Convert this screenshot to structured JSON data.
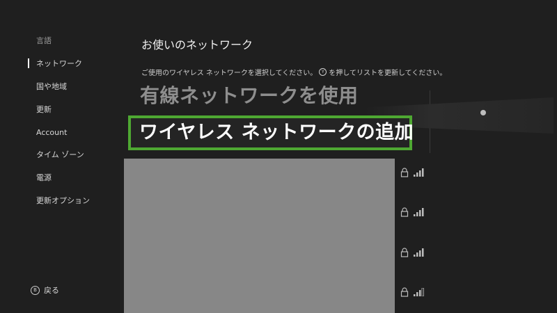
{
  "sidebar": {
    "items": [
      {
        "label": "言語",
        "selected": false
      },
      {
        "label": "ネットワーク",
        "selected": true
      },
      {
        "label": "国や地域",
        "selected": false
      },
      {
        "label": "更新",
        "selected": false
      },
      {
        "label": "Account",
        "selected": false
      },
      {
        "label": "タイム ゾーン",
        "selected": false
      },
      {
        "label": "電源",
        "selected": false
      },
      {
        "label": "更新オプション",
        "selected": false
      }
    ],
    "back": {
      "button_glyph": "B",
      "label": "戻る"
    }
  },
  "main": {
    "title": "お使いのネットワーク",
    "instruction": {
      "before": "ご使用のワイヤレス ネットワークを選択してください。",
      "button_glyph": "Y",
      "after": "を押してリストを更新してください。"
    },
    "wired_option": "有線ネットワークを使用",
    "add_wireless_option": "ワイヤレス ネットワークの追加",
    "networks": [
      {
        "secured": true,
        "signal_bars": 4
      },
      {
        "secured": true,
        "signal_bars": 4
      },
      {
        "secured": true,
        "signal_bars": 4
      },
      {
        "secured": true,
        "signal_bars": 3
      }
    ]
  },
  "colors": {
    "background": "#1f1f1f",
    "focus_border": "#4ea832",
    "redacted": "#878787",
    "dim_text": "#8e8e8e"
  },
  "icons": {
    "lock": "lock-icon",
    "signal": "wifi-signal-icon",
    "controller_b": "b-button-icon",
    "controller_y": "y-button-icon"
  }
}
